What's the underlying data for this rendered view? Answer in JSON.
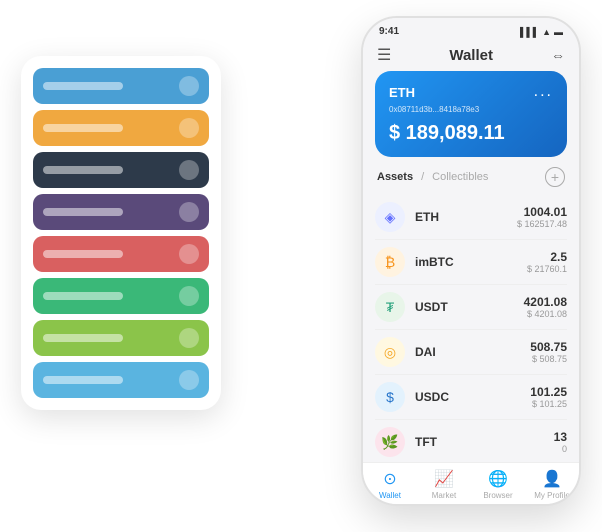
{
  "scene": {
    "cards": [
      {
        "color": "card-blue",
        "label": ""
      },
      {
        "color": "card-orange",
        "label": ""
      },
      {
        "color": "card-dark",
        "label": ""
      },
      {
        "color": "card-purple",
        "label": ""
      },
      {
        "color": "card-red",
        "label": ""
      },
      {
        "color": "card-green",
        "label": ""
      },
      {
        "color": "card-lightgreen",
        "label": ""
      },
      {
        "color": "card-lightblue",
        "label": ""
      }
    ]
  },
  "phone": {
    "status_time": "9:41",
    "header_title": "Wallet",
    "eth_card": {
      "label": "ETH",
      "address": "0x08711d3b...8418a78e3",
      "balance": "$ 189,089.11",
      "dots": "..."
    },
    "assets_tab": "Assets",
    "collectibles_tab": "Collectibles",
    "assets": [
      {
        "name": "ETH",
        "amount": "1004.01",
        "usd": "$ 162517.48",
        "icon": "◈",
        "icon_class": "icon-eth"
      },
      {
        "name": "imBTC",
        "amount": "2.5",
        "usd": "$ 21760.1",
        "icon": "₿",
        "icon_class": "icon-imbtc"
      },
      {
        "name": "USDT",
        "amount": "4201.08",
        "usd": "$ 4201.08",
        "icon": "₮",
        "icon_class": "icon-usdt"
      },
      {
        "name": "DAI",
        "amount": "508.75",
        "usd": "$ 508.75",
        "icon": "◎",
        "icon_class": "icon-dai"
      },
      {
        "name": "USDC",
        "amount": "101.25",
        "usd": "$ 101.25",
        "icon": "$",
        "icon_class": "icon-usdc"
      },
      {
        "name": "TFT",
        "amount": "13",
        "usd": "0",
        "icon": "🌿",
        "icon_class": "icon-tft"
      }
    ],
    "nav": [
      {
        "label": "Wallet",
        "icon": "⊙",
        "active": true
      },
      {
        "label": "Market",
        "icon": "📊",
        "active": false
      },
      {
        "label": "Browser",
        "icon": "👤",
        "active": false
      },
      {
        "label": "My Profile",
        "icon": "👤",
        "active": false
      }
    ]
  }
}
